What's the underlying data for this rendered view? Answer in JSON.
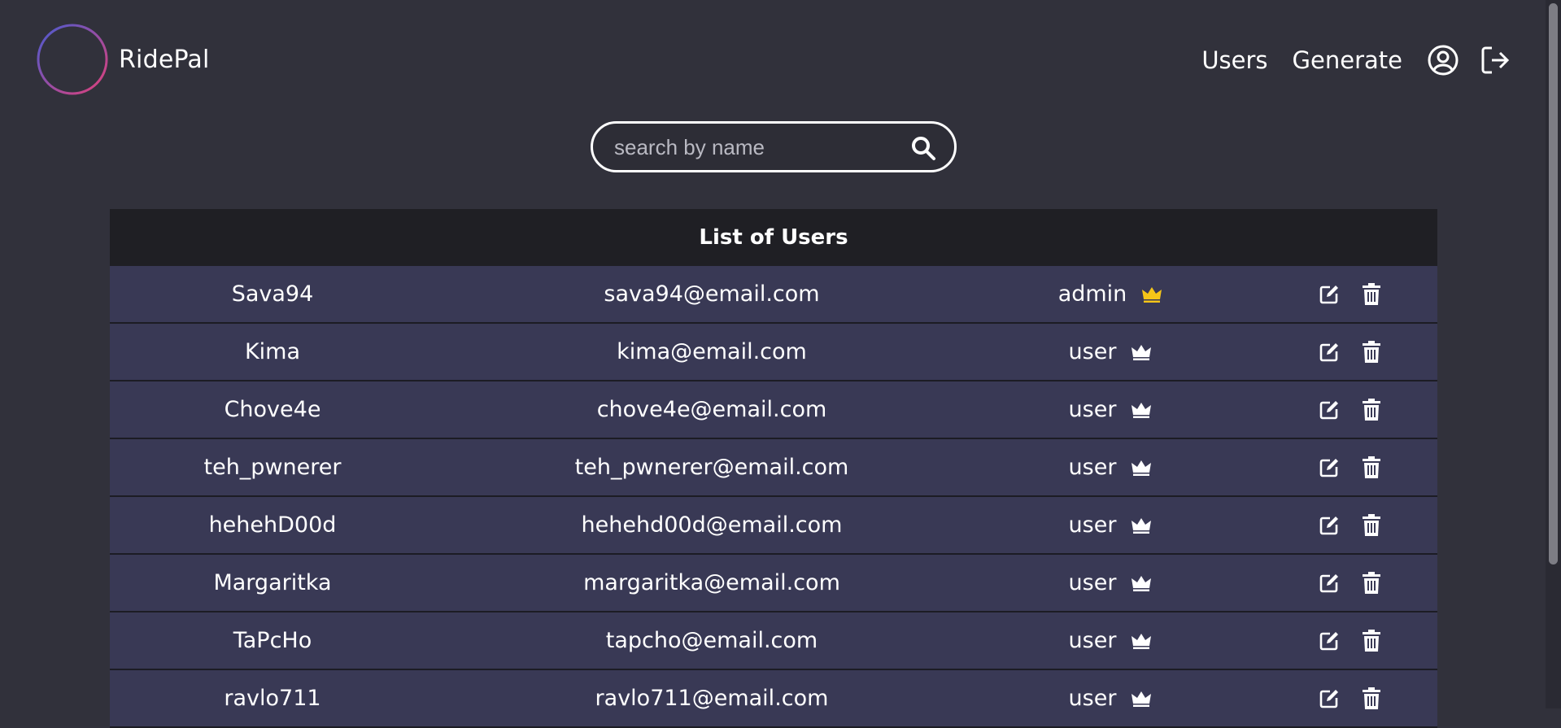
{
  "brand": {
    "name": "RidePal"
  },
  "nav": {
    "users_label": "Users",
    "generate_label": "Generate",
    "profile_icon": "user-circle-icon",
    "logout_icon": "sign-out-icon"
  },
  "search": {
    "placeholder": "search by name",
    "value": ""
  },
  "table": {
    "title": "List of Users",
    "rows": [
      {
        "name": "Sava94",
        "email": "sava94@email.com",
        "role": "admin"
      },
      {
        "name": "Kima",
        "email": "kima@email.com",
        "role": "user"
      },
      {
        "name": "Chove4e",
        "email": "chove4e@email.com",
        "role": "user"
      },
      {
        "name": "teh_pwnerer",
        "email": "teh_pwnerer@email.com",
        "role": "user"
      },
      {
        "name": "hehehD00d",
        "email": "hehehd00d@email.com",
        "role": "user"
      },
      {
        "name": "Margaritka",
        "email": "margaritka@email.com",
        "role": "user"
      },
      {
        "name": "TaPcHo",
        "email": "tapcho@email.com",
        "role": "user"
      },
      {
        "name": "ravlo711",
        "email": "ravlo711@email.com",
        "role": "user"
      }
    ]
  },
  "colors": {
    "background": "#31313b",
    "row_bg": "#393955",
    "header_bg": "#1f1f24",
    "admin_crown": "#f5c518",
    "user_crown": "#ffffff"
  }
}
